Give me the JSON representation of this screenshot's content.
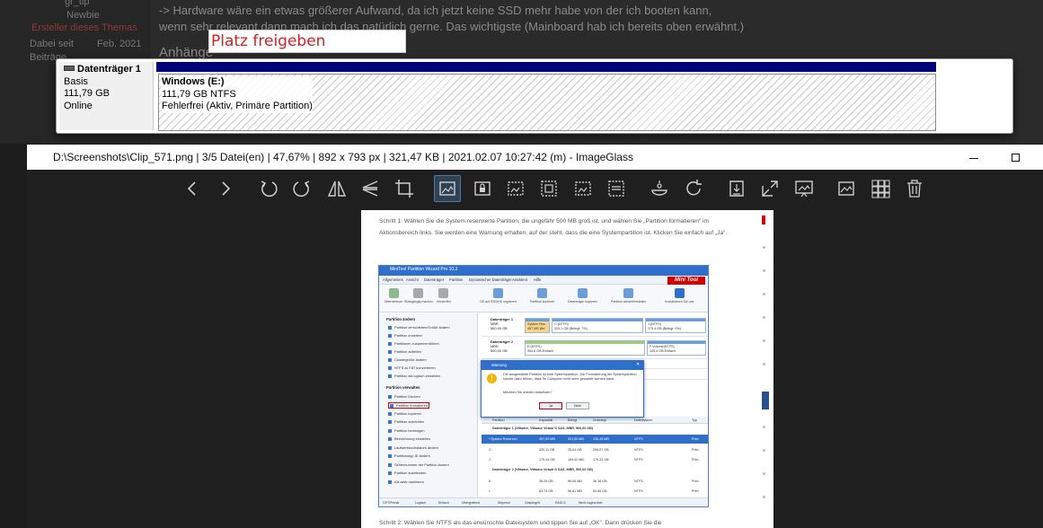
{
  "forum": {
    "user_name": "gr_tip",
    "rank": "Newbie",
    "creator_badge": "Ersteller dieses Themas",
    "joined_label": "Dabei seit",
    "joined_value": "Feb. 2021",
    "posts_label": "Beiträge",
    "post_line_1": "-> Hardware wäre ein etwas größerer Aufwand, da ich jetzt keine SSD mehr habe von der ich booten kann,",
    "post_line_2": "wenn sehr relevant dann mach ich das natürlich gerne. Das wichtigste (Mainboard hab ich bereits oben erwähnt.)",
    "attachments_label": "Anhänge"
  },
  "tooltip": {
    "text": "Platz freigeben"
  },
  "disk": {
    "name": "Datenträger 1",
    "type": "Basis",
    "size": "111,79 GB",
    "status": "Online",
    "partition": {
      "name": "Windows  (E:)",
      "size_fs": "111,79 GB NTFS",
      "state": "Fehlerfrei (Aktiv, Primäre Partition)"
    }
  },
  "imageglass": {
    "title": "D:\\Screenshots\\Clip_571.png  |  3/5 Datei(en)  |  47,67%  |  892 x 793 px  |  321,47 KB  |  2021.02.07 10:27:42 (m)  - ImageGlass",
    "minimize": "—",
    "toolbar_icons": [
      "chevron-left-icon",
      "chevron-right-icon",
      "rotate-left-icon",
      "rotate-right-icon",
      "flip-horizontal-icon",
      "flip-vertical-icon",
      "crop-icon",
      "auto-zoom-icon",
      "lock-zoom-icon",
      "scale-to-width-icon",
      "scale-to-height-icon",
      "scale-to-fit-icon",
      "scale-to-fill-icon",
      "slideshow-icon",
      "refresh-icon",
      "open-with-icon",
      "fullscreen-icon",
      "set-wallpaper-icon",
      "thumbnail-bar-icon",
      "grid-icon",
      "delete-icon"
    ]
  },
  "document": {
    "step1": "Schritt 1: Wählen Sie die System reservierte Partition, die ungefähr 500 MB groß ist, und wählen Sie „Partition formatieren\" im Aktionsbereich links. Sie werden eine Warnung erhalten, auf der steht, dass die eine Systempartition ist. Klicken Sie einfach auf „Ja\".",
    "step2": "Schritt 2: Wählen Sie NTFS als das erwünschte Dateisystem und tippen Sie auf „OK\". Dann drücken Sie die",
    "minitool": {
      "title": "MiniTool Partition Wizard Pro 10.3",
      "menu": [
        "Allgemeines",
        "Ansicht",
        "Datenträger",
        "Partition",
        "Dynamischer Datenträger",
        "Assistent",
        "Hilfe"
      ],
      "logo": "Mini Tool",
      "tools_left": [
        "Übernehmen",
        "Rückgängig machen",
        "Verwerfen"
      ],
      "tools_right": [
        "OS auf SSD/HD migrieren",
        "Partition kopieren",
        "Datenträger kopieren",
        "Partition wiederherstellen",
        "Kontaktieren Sie uns"
      ],
      "side_header_1": "Partition ändern",
      "side_items_1": [
        "Partition verschieben/Größe ändern",
        "Partition erweitern",
        "Partitionen zusammenführen",
        "Partition aufteilen",
        "Clustergröße ändern",
        "NTFS zu FAT konvertieren",
        "Partition als logisch einstellen"
      ],
      "side_header_2": "Partition verwalten",
      "side_items_2": [
        "Partition löschen",
        "Partition formatieren",
        "Partition kopieren",
        "Partition ausrichten",
        "Partition bereinigen",
        "Bezeichnung einstellen",
        "Laufwerkbuchstaben ändern",
        "Partitionstyp-ID ändern",
        "Seriennummer der Partition ändern",
        "Partition ausblenden",
        "Als aktiv markieren"
      ],
      "disk1_name": "Datenträger 1",
      "disk1_style": "MBR",
      "disk1_size": "500,00 GB",
      "disk1_seg1": "System Res",
      "disk1_seg1b": "457 MB (Be",
      "disk1_seg2": "C:(NTFS)",
      "disk1_seg2b": "320,1 GB (Belegt: 7%)",
      "disk1_seg3": "J:(NTFS)",
      "disk1_seg3b": "179,4 GB (Belegt: 0%)",
      "disk2_name": "Datenträger 2",
      "disk2_style": "MBR",
      "disk2_size": "500,00 GB",
      "disk2_seg1": "E:(NTFS)",
      "disk2_seg1b": "354,6 GB,Einfach",
      "disk2_seg2": "F:Volume(NTFS)",
      "disk2_seg2b": "145,4 GB,Einfach",
      "col_headers": [
        "Partition",
        "Kapazität",
        "Belegt",
        "Unbelegt",
        "Dateisystem",
        "Typ"
      ],
      "group1": "Datenträger 1 (VMware, VMware Virtual S SAS, MBR, 500,00 GB)",
      "rows1": [
        [
          "*:System Reserved",
          "457,00 MB",
          "321,55 MB",
          "135,45 MB",
          "NTFS",
          "Prim"
        ],
        [
          "C:",
          "320,11 GB",
          "25,04 GB",
          "295,07 GB",
          "NTFS",
          "Prim"
        ],
        [
          "J:",
          "179,44 GB",
          "169,02 MB",
          "179,33 GB",
          "NTFS",
          "Prim"
        ]
      ],
      "group2": "Datenträger 2 (VMware, VMware Virtual S SAS, MBR, 500,00 GB)",
      "rows2": [
        [
          "E:",
          "36,25 GB",
          "96,05 MB",
          "36,16 GB",
          "NTFS",
          "Prim"
        ],
        [
          "I:",
          "63,74 GB",
          "96,81 MB",
          "63,65 GB",
          "NTFS",
          "Prim"
        ]
      ],
      "legend": [
        "GPT/Primär",
        "Logisch",
        "Einfach",
        "Übergreifend",
        "Stripesot",
        "Gespiegelt",
        "RAID-5",
        "Nicht zugeordnet"
      ],
      "warning": {
        "title": "Warnung",
        "message": "Die ausgewählte Partition ist eine Systempartition. Die Formatierung der Systempartition könnte dazu führen, dass Ihr Computer nicht mehr gestartet werden kann.",
        "question": "Möchten Sie wirklich fortsetzen?",
        "yes": "Ja",
        "no": "Nein"
      }
    }
  },
  "colors": {
    "partition_bar": "#00007a",
    "toolbar_active": "#2f4254",
    "tooltip_text": "#d31f1f",
    "minitool_blue": "#2f6fca"
  }
}
